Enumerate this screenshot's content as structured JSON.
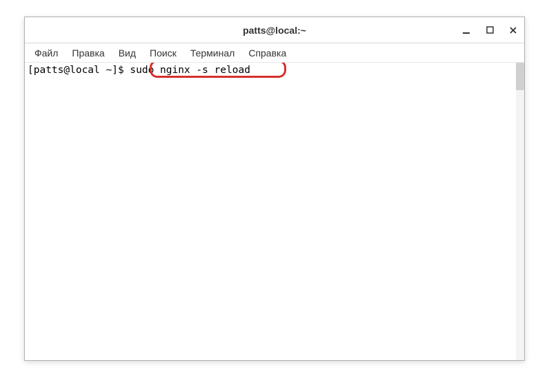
{
  "window": {
    "title": "patts@local:~"
  },
  "menubar": {
    "items": [
      {
        "label": "Файл"
      },
      {
        "label": "Правка"
      },
      {
        "label": "Вид"
      },
      {
        "label": "Поиск"
      },
      {
        "label": "Терминал"
      },
      {
        "label": "Справка"
      }
    ]
  },
  "terminal": {
    "prompt": "[patts@local ~]$ ",
    "command": "sudo nginx -s reload"
  },
  "icons": {
    "minimize": "━",
    "maximize": "▫",
    "close": "✕"
  }
}
